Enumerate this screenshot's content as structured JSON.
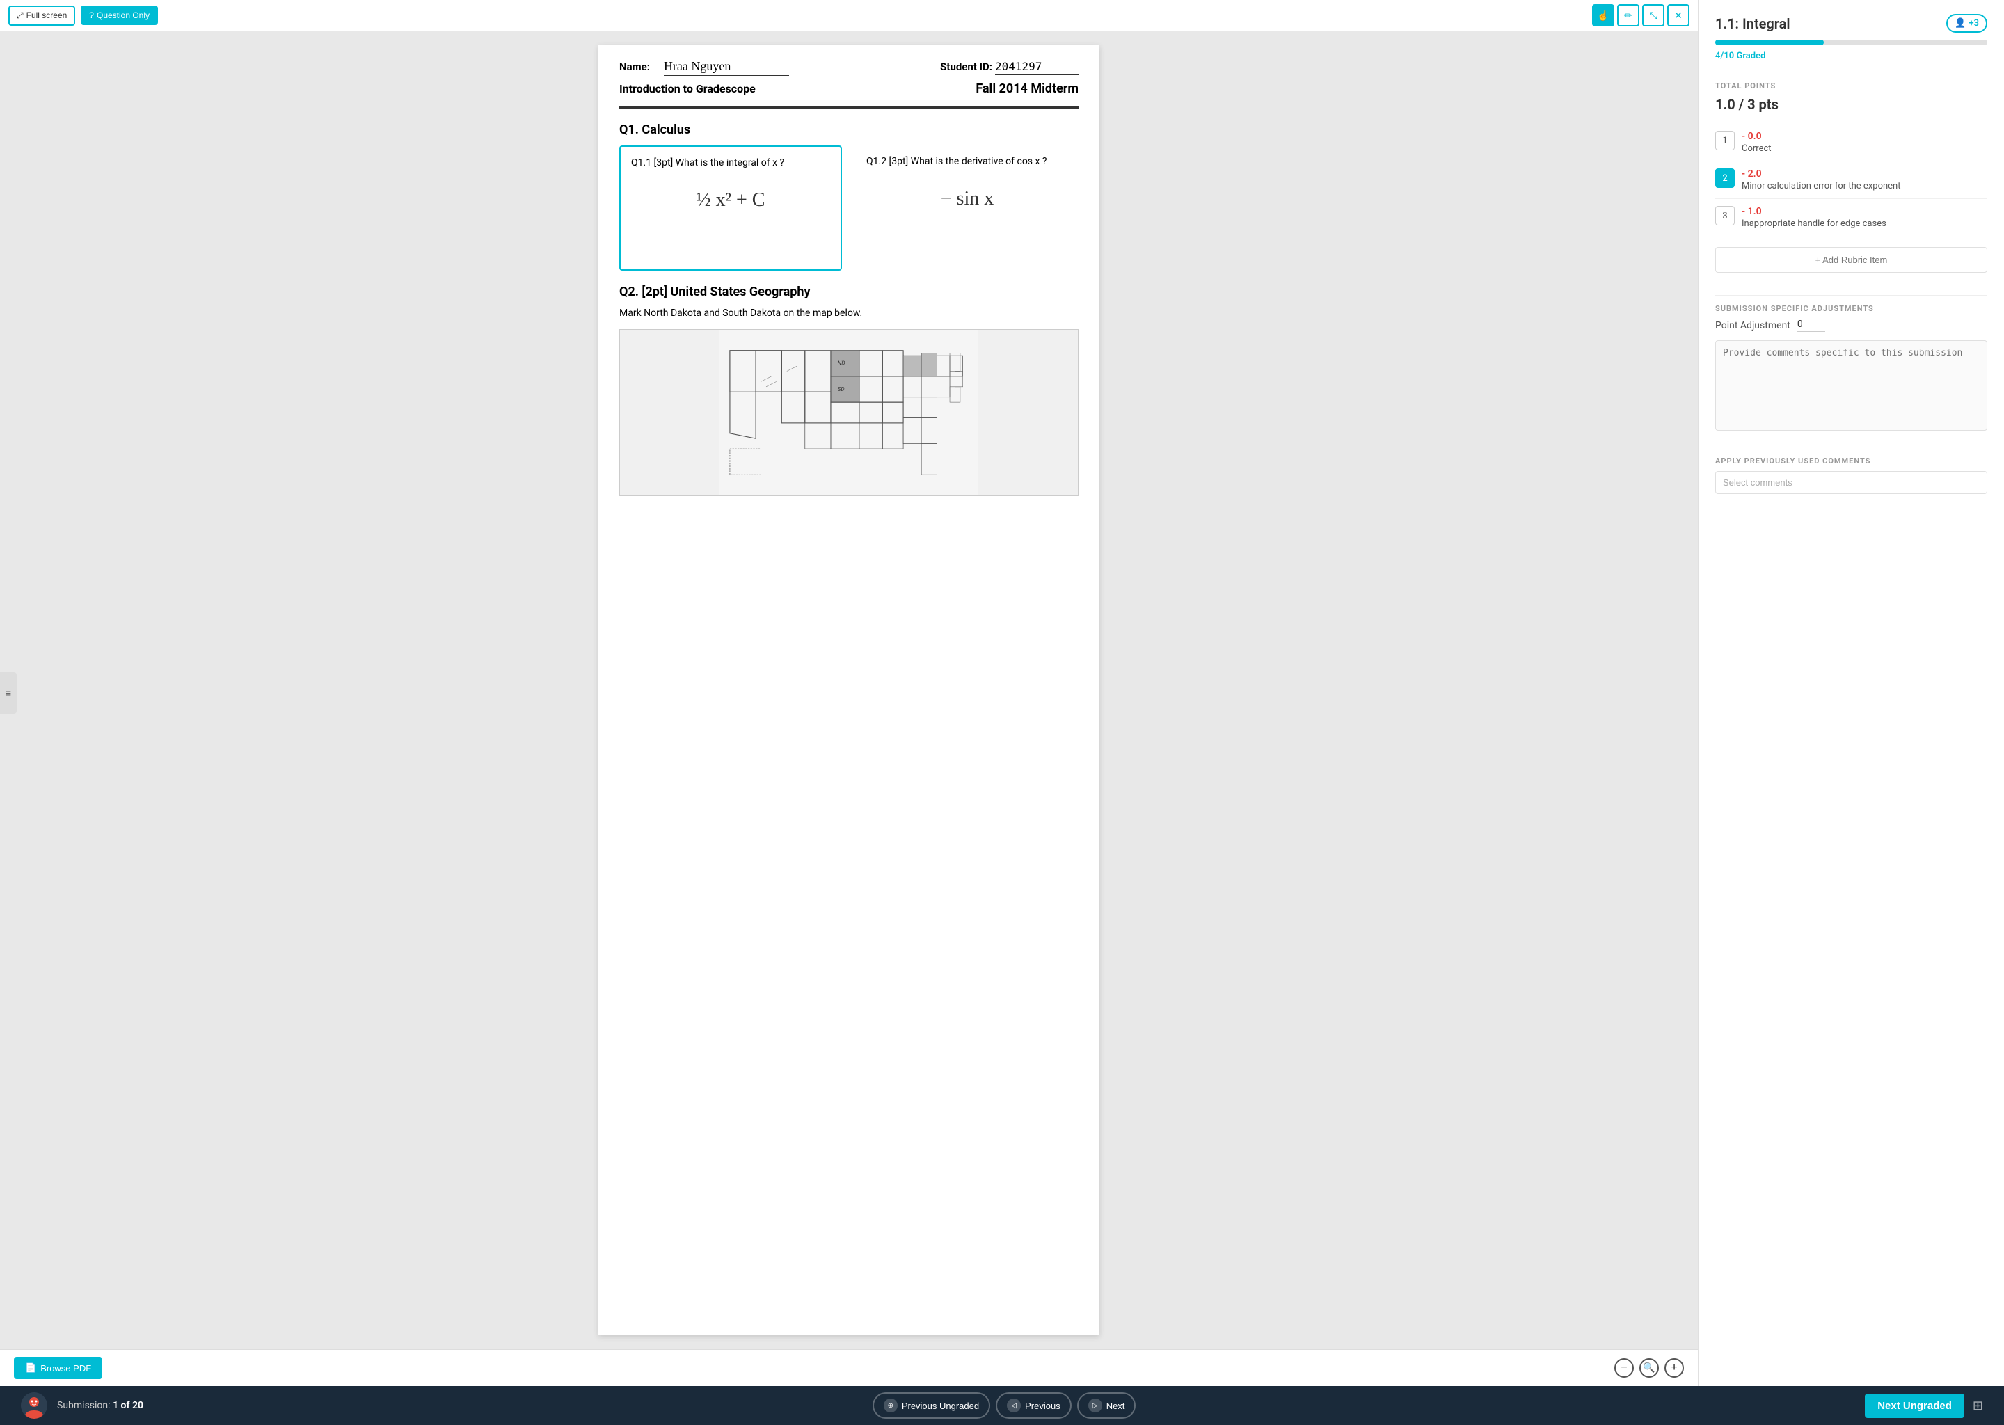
{
  "toolbar": {
    "fullscreen_label": "Full screen",
    "question_only_label": "Question Only",
    "fullscreen_icon": "⤢",
    "question_icon": "?",
    "pen_icon": "✏",
    "expand_icon": "⤡",
    "close_icon": "✕"
  },
  "document": {
    "name_label": "Name:",
    "name_value": "Hraa Nguyen",
    "id_label": "Student ID:",
    "id_value": "2041297",
    "course": "Introduction to Gradescope",
    "exam": "Fall 2014 Midterm",
    "q1_title": "Q1.  Calculus",
    "q11_label": "Q1.1  [3pt]  What is the integral of x ?",
    "q11_answer": "½ x² + C",
    "q12_label": "Q1.2  [3pt]   What is the derivative of  cos x ?",
    "q12_answer": "- sin x",
    "q2_title": "Q2.  [2pt] United States Geography",
    "q2_description": "Mark North Dakota and South Dakota on the map below."
  },
  "doc_bottom": {
    "browse_pdf_label": "Browse PDF",
    "zoom_minus": "−",
    "zoom_plus": "+"
  },
  "grading": {
    "title": "1.1: Integral",
    "graders_label": "+3",
    "progress_percent": 40,
    "graded_label": "4/10 Graded",
    "total_points_label": "TOTAL POINTS",
    "total_points_value": "1.0 / 3 pts",
    "rubric_items": [
      {
        "num": "1",
        "score": "- 0.0",
        "desc": "Correct",
        "active": false
      },
      {
        "num": "2",
        "score": "- 2.0",
        "desc": "Minor calculation error for the exponent",
        "active": true
      },
      {
        "num": "3",
        "score": "- 1.0",
        "desc": "Inappropriate handle for edge cases",
        "active": false
      }
    ],
    "add_rubric_label": "+ Add Rubric Item",
    "adjustments_label": "SUBMISSION SPECIFIC ADJUSTMENTS",
    "point_adj_label": "Point Adjustment",
    "point_adj_value": "0",
    "comments_placeholder": "Provide comments specific to this submission",
    "prev_comments_label": "APPLY PREVIOUSLY USED COMMENTS",
    "select_comments_placeholder": "Select comments"
  },
  "nav": {
    "submission_label": "Submission:",
    "submission_current": "1",
    "submission_total": "20",
    "prev_ungraded_label": "Previous Ungraded",
    "prev_label": "Previous",
    "next_label": "Next",
    "next_ungraded_label": "Next Ungraded"
  }
}
